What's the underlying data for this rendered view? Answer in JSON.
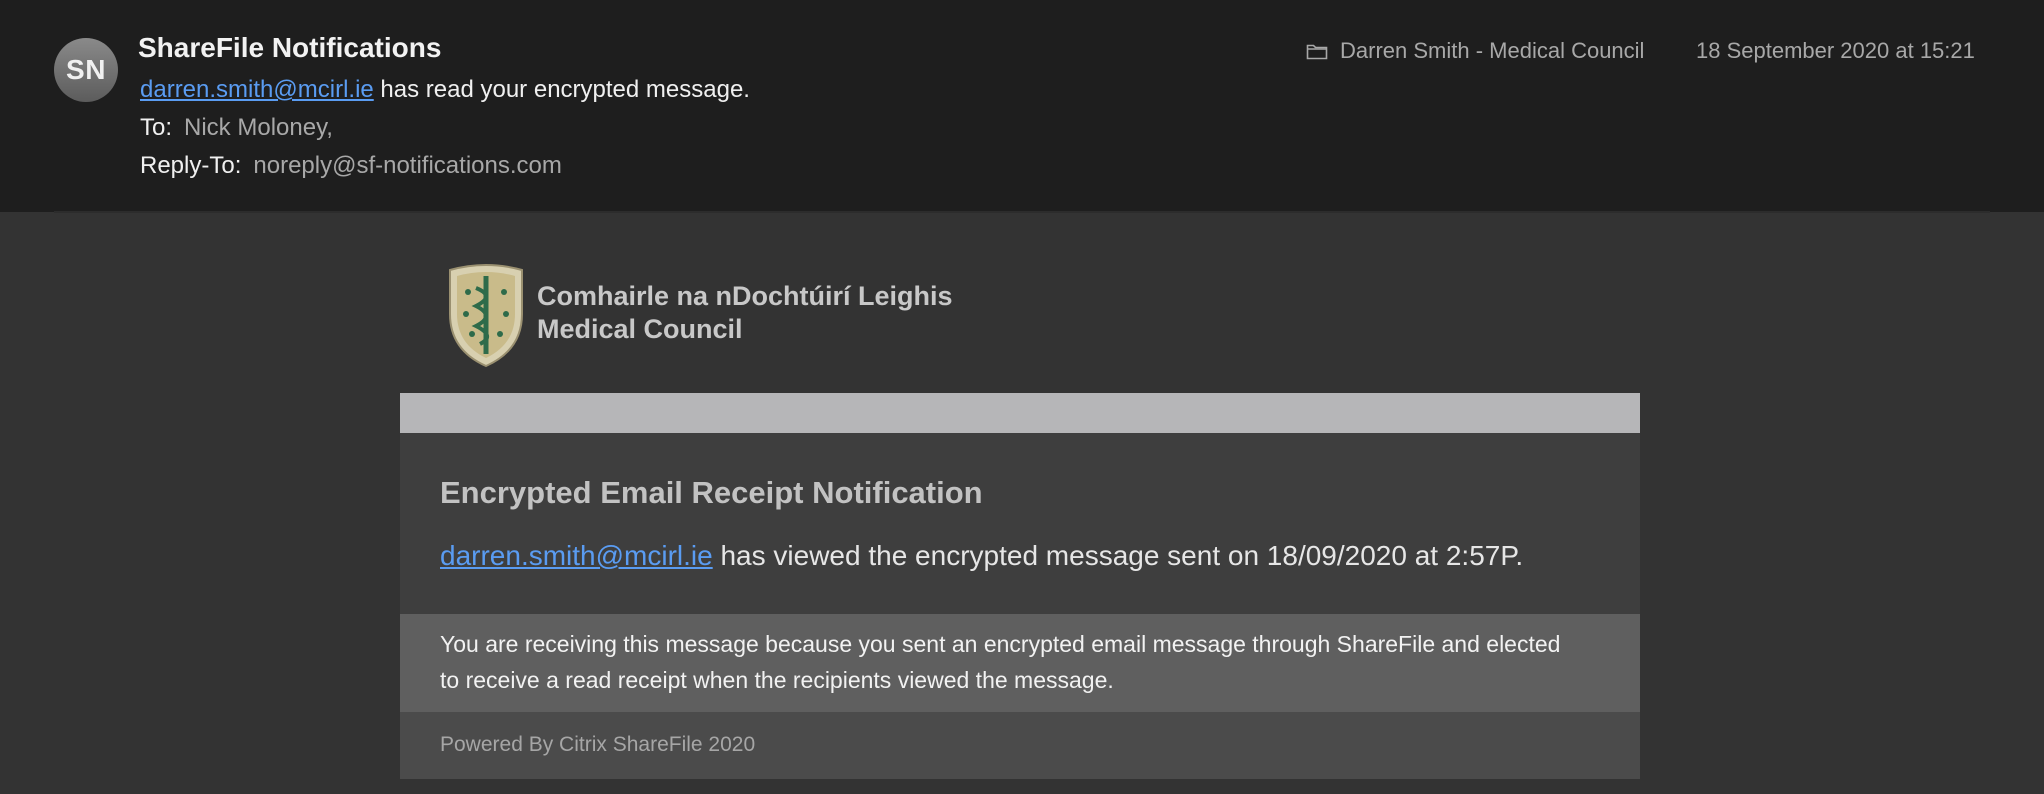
{
  "header": {
    "avatar_initials": "SN",
    "sender_name": "ShareFile Notifications",
    "subject_link": "darren.smith@mcirl.ie",
    "subject_rest": " has read your encrypted message.",
    "to_label": "To:",
    "to_value": "Nick Moloney,",
    "reply_to_label": "Reply-To:",
    "reply_to_value": "noreply@sf-notifications.com",
    "mailbox_icon": "folder-icon",
    "mailbox": "Darren Smith - Medical Council",
    "date": "18 September 2020 at 15:21"
  },
  "body": {
    "logo_icon": "medical-council-crest-logo",
    "org_name_line1": "Comhairle na nDochtúirí Leighis",
    "org_name_line2": "Medical Council",
    "card_title": "Encrypted Email Receipt Notification",
    "viewer_link": "darren.smith@mcirl.ie",
    "viewed_text": " has viewed the encrypted message sent on 18/09/2020 at 2:57P.",
    "note": "You are receiving this message because you sent an encrypted email message through ShareFile and elected to receive a read receipt when the recipients viewed the message.",
    "footer": "Powered By Citrix ShareFile 2020"
  },
  "colors": {
    "link": "#5a9cf2",
    "header_bg": "#1e1e1e",
    "body_bg": "#333333",
    "crest_green": "#2e6b4a",
    "crest_gold": "#c9bb8a"
  }
}
